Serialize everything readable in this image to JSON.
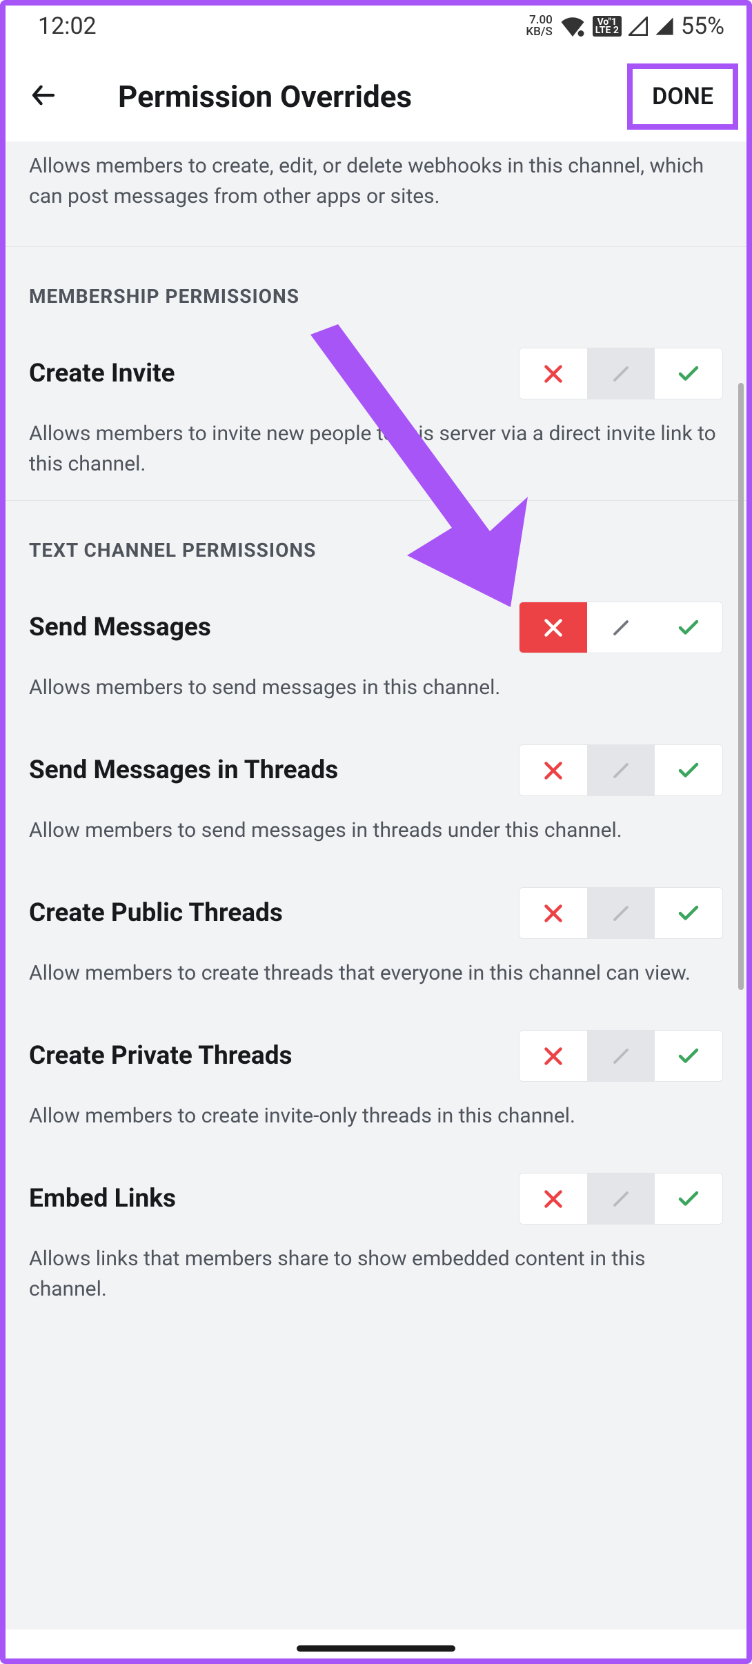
{
  "statusBar": {
    "time": "12:02",
    "kbs_top": "7.00",
    "kbs_bottom": "KB/S",
    "lte_top": "Vo\"1",
    "lte_bottom": "LTE 2",
    "battery": "55%"
  },
  "header": {
    "title": "Permission Overrides",
    "done": "DONE"
  },
  "intro_description": "Allows members to create, edit, or delete webhooks in this channel, which can post messages from other apps or sites.",
  "sections": [
    {
      "title": "MEMBERSHIP PERMISSIONS",
      "items": [
        {
          "title": "Create Invite",
          "description": "Allows members to invite new people to this server via a direct invite link to this channel.",
          "state": "neutral"
        }
      ]
    },
    {
      "title": "TEXT CHANNEL PERMISSIONS",
      "items": [
        {
          "title": "Send Messages",
          "description": "Allows members to send messages in this channel.",
          "state": "deny"
        },
        {
          "title": "Send Messages in Threads",
          "description": "Allow members to send messages in threads under this channel.",
          "state": "neutral"
        },
        {
          "title": "Create Public Threads",
          "description": "Allow members to create threads that everyone in this channel can view.",
          "state": "neutral"
        },
        {
          "title": "Create Private Threads",
          "description": "Allow members to create invite-only threads in this channel.",
          "state": "neutral"
        },
        {
          "title": "Embed Links",
          "description": "Allows links that members share to show embedded content in this channel.",
          "state": "neutral"
        }
      ]
    }
  ]
}
